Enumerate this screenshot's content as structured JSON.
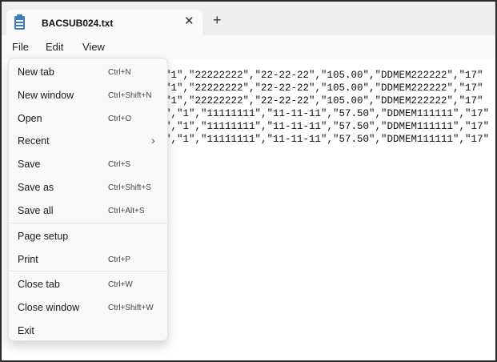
{
  "tab": {
    "title": "BACSUB024.txt",
    "close_glyph": "✕",
    "new_glyph": "+"
  },
  "menubar": {
    "file": "File",
    "edit": "Edit",
    "view": "View"
  },
  "editor": {
    "lines": [
      "\"1\",\"22222222\",\"22-22-22\",\"105.00\",\"DDMEM222222\",\"17\"",
      "\"1\",\"22222222\",\"22-22-22\",\"105.00\",\"DDMEM222222\",\"17\"",
      "\"1\",\"22222222\",\"22-22-22\",\"105.00\",\"DDMEM222222\",\"17\"",
      "\",\"1\",\"11111111\",\"11-11-11\",\"57.50\",\"DDMEM111111\",\"17\"",
      "\",\"1\",\"11111111\",\"11-11-11\",\"57.50\",\"DDMEM111111\",\"17\"",
      "\",\"1\",\"11111111\",\"11-11-11\",\"57.50\",\"DDMEM111111\",\"17\""
    ]
  },
  "file_menu": {
    "items": [
      {
        "label": "New tab",
        "shortcut": "Ctrl+N"
      },
      {
        "label": "New window",
        "shortcut": "Ctrl+Shift+N"
      },
      {
        "label": "Open",
        "shortcut": "Ctrl+O"
      },
      {
        "label": "Recent",
        "shortcut": "",
        "chevron": "›"
      },
      {
        "label": "Save",
        "shortcut": "Ctrl+S"
      },
      {
        "label": "Save as",
        "shortcut": "Ctrl+Shift+S"
      },
      {
        "label": "Save all",
        "shortcut": "Ctrl+Alt+S"
      },
      {
        "label": "Page setup",
        "shortcut": ""
      },
      {
        "label": "Print",
        "shortcut": "Ctrl+P"
      },
      {
        "label": "Close tab",
        "shortcut": "Ctrl+W"
      },
      {
        "label": "Close window",
        "shortcut": "Ctrl+Shift+W"
      },
      {
        "label": "Exit",
        "shortcut": ""
      }
    ]
  },
  "colors": {
    "icon_blue": "#3b7dc4",
    "frame_border": "#2b2b2b"
  }
}
